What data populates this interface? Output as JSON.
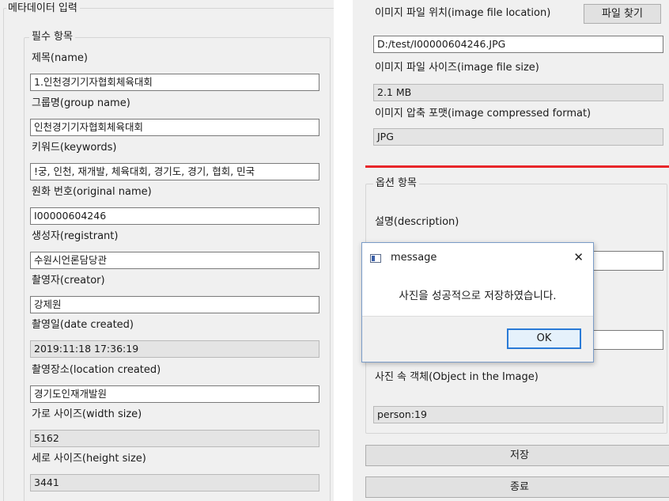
{
  "left": {
    "group_title": "메타데이터 입력",
    "required_title": "필수 항목",
    "fields": [
      {
        "label": "제목(name)",
        "value": "1.인천경기기자협회체육대회",
        "readonly": false
      },
      {
        "label": "그룹명(group name)",
        "value": "인천경기기자협회체육대회",
        "readonly": false
      },
      {
        "label": "키워드(keywords)",
        "value": "!궁, 인천, 재개발, 체육대회, 경기도, 경기, 협회, 민국",
        "readonly": false
      },
      {
        "label": "원화 번호(original name)",
        "value": "I00000604246",
        "readonly": false
      },
      {
        "label": "생성자(registrant)",
        "value": "수원시언론담당관",
        "readonly": false
      },
      {
        "label": "촬영자(creator)",
        "value": "강제원",
        "readonly": false
      },
      {
        "label": "촬영일(date created)",
        "value": "2019:11:18 17:36:19",
        "readonly": true
      },
      {
        "label": "촬영장소(location created)",
        "value": "경기도인재개발원",
        "readonly": false
      },
      {
        "label": "가로 사이즈(width size)",
        "value": "5162",
        "readonly": true
      },
      {
        "label": "세로 사이즈(height size)",
        "value": "3441",
        "readonly": true
      }
    ]
  },
  "right": {
    "file_location_label": "이미지 파일 위치(image file location)",
    "find_file_button": "파일 찾기",
    "file_location_value": "D:/test/I00000604246.JPG",
    "file_size_label": "이미지 파일 사이즈(image file size)",
    "file_size_value": "2.1 MB",
    "format_label": "이미지 압축 포맷(image compressed format)",
    "format_value": "JPG",
    "optional_title": "옵션 항목",
    "description_label": "설명(description)",
    "objects_label": "사진 속 객체(Object in the Image)",
    "objects_value": "person:19",
    "save_button": "저장",
    "exit_button": "종료",
    "accent_color": "#e8262a"
  },
  "dialog": {
    "title": "message",
    "message": "사진을 성공적으로 저장하였습니다.",
    "ok_button": "OK",
    "close_symbol": "✕"
  }
}
